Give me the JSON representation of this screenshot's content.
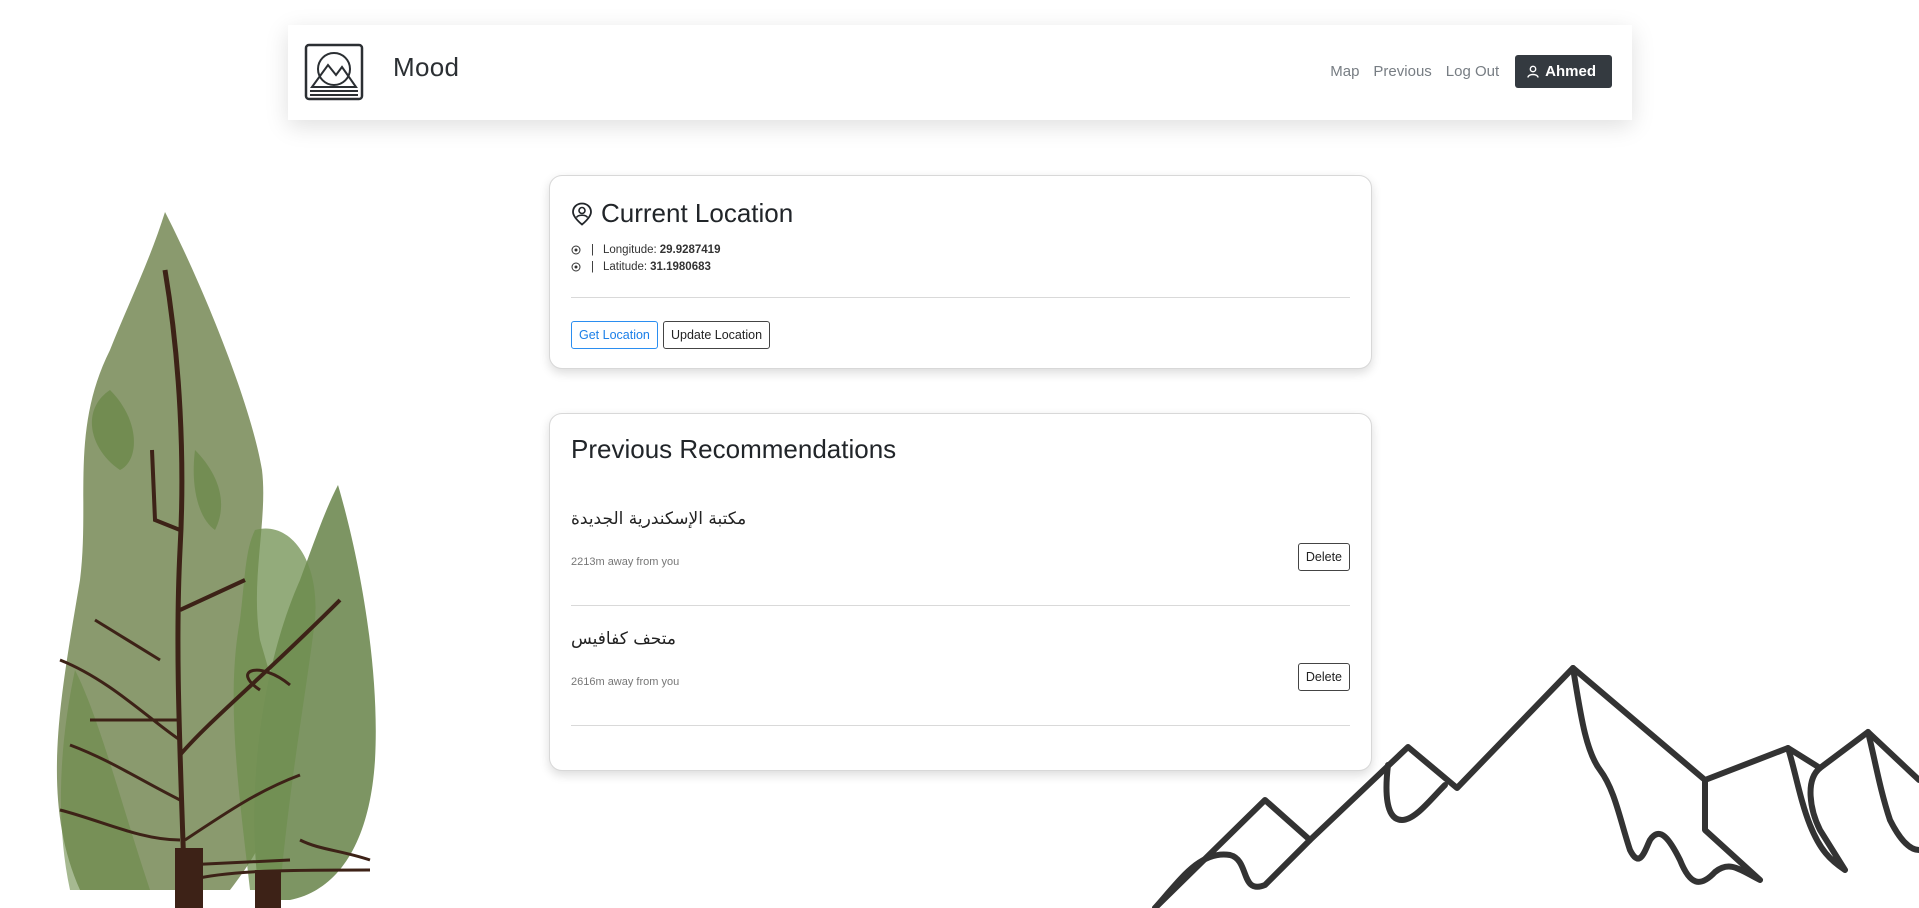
{
  "navbar": {
    "brand": "Mood",
    "links": [
      "Map",
      "Previous",
      "Log Out"
    ],
    "user_name": "Ahmed",
    "user_icon": "person-icon",
    "logo_icon": "mountain-logo"
  },
  "location_card": {
    "title": "Current Location",
    "title_icon": "location-pin-icon",
    "longitude_label": "Longitude:",
    "longitude_value": "29.9287419",
    "latitude_label": "Latitude:",
    "latitude_value": "31.1980683",
    "separator": "|",
    "get_button": "Get Location",
    "update_button": "Update Location"
  },
  "recommendations_card": {
    "title": "Previous Recommendations",
    "items": [
      {
        "name": "مكتبة الإسكندرية الجديدة",
        "distance": "2213m away from you",
        "delete_label": "Delete"
      },
      {
        "name": "متحف كفافيس",
        "distance": "2616m away from you",
        "delete_label": "Delete"
      }
    ]
  },
  "colors": {
    "accent_blue": "#1b7fe8",
    "dark_button": "#343a40",
    "tree_green": "#7f9a66",
    "tree_trunk": "#3d2217",
    "mountain_stroke": "#333333"
  }
}
